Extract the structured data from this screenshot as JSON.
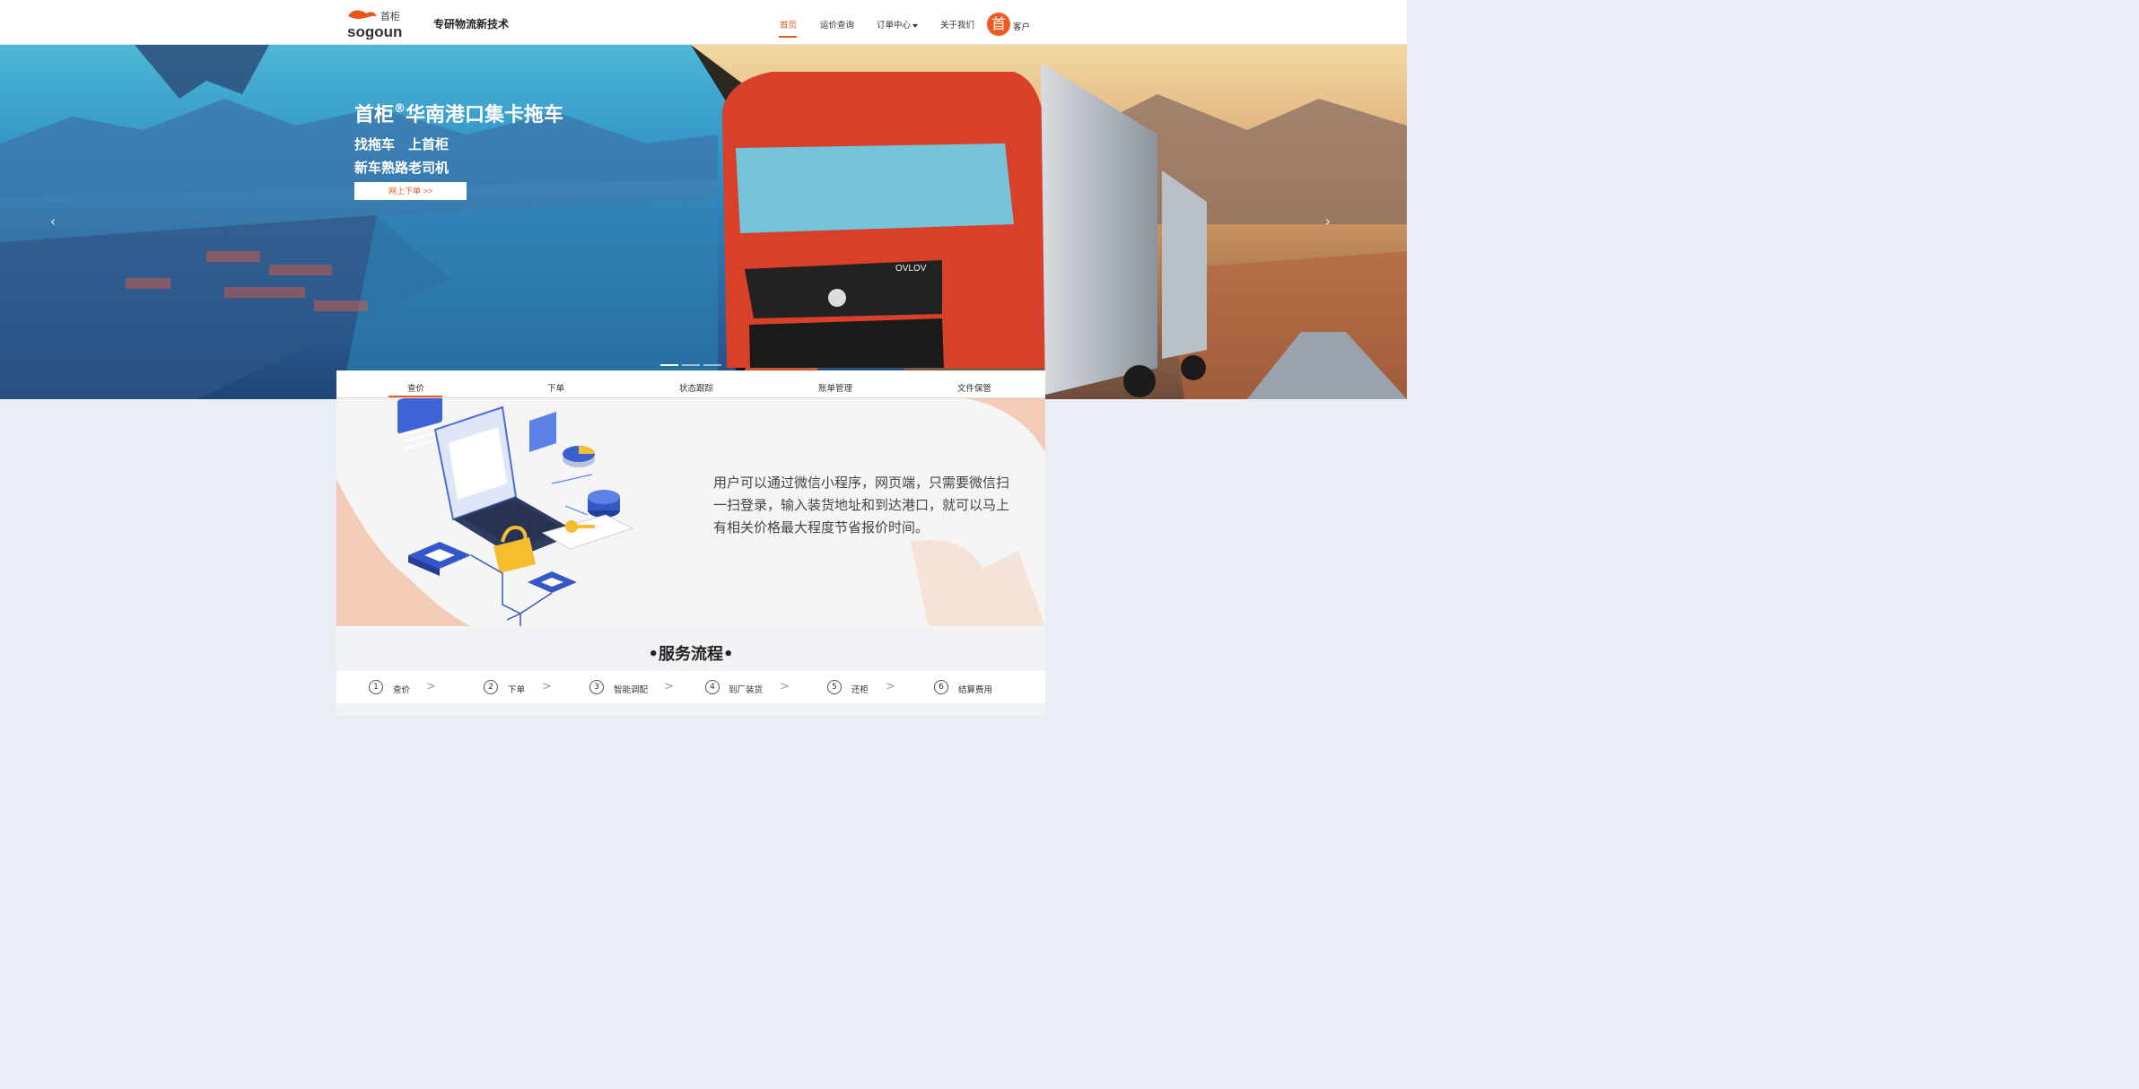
{
  "header": {
    "logo_text": "sogoun",
    "logo_cn": "首柜",
    "slogan": "专研物流新技术",
    "nav": [
      {
        "label": "首页",
        "active": true
      },
      {
        "label": "运价查询",
        "active": false
      },
      {
        "label": "订单中心",
        "active": false,
        "dropdown": true
      },
      {
        "label": "关于我们",
        "active": false
      }
    ],
    "user_avatar_glyph": "首",
    "user_label": "客户"
  },
  "hero": {
    "title": "首柜",
    "title_mark": "®",
    "title_rest": "华南港口集卡拖车",
    "line1": "找拖车　上首柜",
    "line2": "新车熟路老司机",
    "button": "网上下单 >>",
    "prev_arrow": "‹",
    "next_arrow": "›",
    "slides": 3,
    "active_slide": 0
  },
  "tabs": [
    {
      "label": "查价",
      "active": true
    },
    {
      "label": "下单",
      "active": false
    },
    {
      "label": "状态跟踪",
      "active": false
    },
    {
      "label": "账单管理",
      "active": false
    },
    {
      "label": "文件保管",
      "active": false
    }
  ],
  "content": {
    "description": "用户可以通过微信小程序，网页端，只需要微信扫一扫登录，输入装货地址和到达港口，就可以马上有相关价格最大程度节省报价时间。"
  },
  "flow": {
    "title": "•服务流程•",
    "steps": [
      {
        "num": "1",
        "label": "查价"
      },
      {
        "num": "2",
        "label": "下单"
      },
      {
        "num": "3",
        "label": "智能调配"
      },
      {
        "num": "4",
        "label": "到厂装货"
      },
      {
        "num": "5",
        "label": "还柜"
      },
      {
        "num": "6",
        "label": "结算费用"
      }
    ],
    "separator": ">"
  },
  "colors": {
    "accent": "#e8571e",
    "truck_red": "#d9402a",
    "sky_blue": "#4fb7d6"
  }
}
